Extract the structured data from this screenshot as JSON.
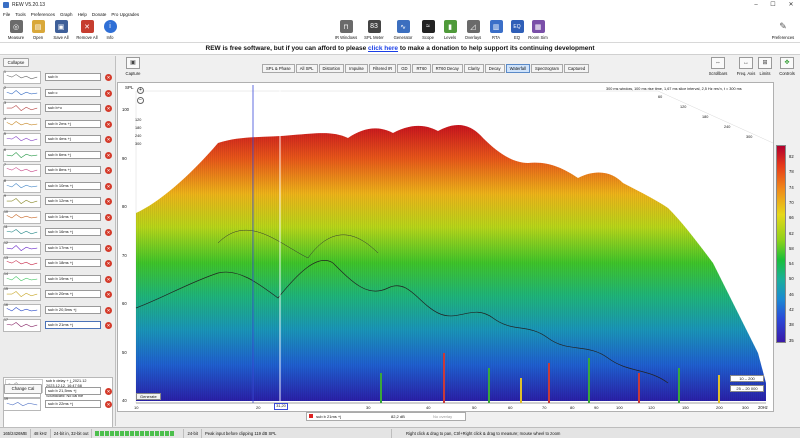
{
  "window": {
    "title": "REW V5.20.13",
    "minimize": "–",
    "maximize": "☐",
    "close": "✕"
  },
  "menu": [
    "File",
    "Tools",
    "Preferences",
    "Graph",
    "Help",
    "Donate",
    "Pro Upgrades"
  ],
  "toolbar": {
    "left": [
      {
        "label": "Measure",
        "icon": "measure-icon",
        "color": "#6b6b6b",
        "glyph": "◎"
      },
      {
        "label": "Open",
        "icon": "folder-icon",
        "color": "#d9a83a",
        "glyph": "▤"
      },
      {
        "label": "Save All",
        "icon": "save-icon",
        "color": "#3e5f99",
        "glyph": "▣"
      },
      {
        "label": "Remove All",
        "icon": "remove-all-icon",
        "color": "#c63d2f",
        "glyph": "✕"
      },
      {
        "label": "Info",
        "icon": "info-icon",
        "color": "#2f6fd6",
        "glyph": "i"
      }
    ],
    "right": [
      {
        "label": "IR Windows",
        "icon": "ir-windows-icon",
        "color": "#6a6a6a",
        "glyph": "⊓"
      },
      {
        "label": "SPL Meter",
        "icon": "spl-meter-icon",
        "color": "#444444",
        "glyph": "83"
      },
      {
        "label": "Generator",
        "icon": "generator-icon",
        "color": "#3c6fbf",
        "glyph": "∿"
      },
      {
        "label": "Scope",
        "icon": "scope-icon",
        "color": "#222222",
        "glyph": "≈"
      },
      {
        "label": "Levels",
        "icon": "levels-icon",
        "color": "#4f9a3a",
        "glyph": "▮"
      },
      {
        "label": "Overlays",
        "icon": "overlays-icon",
        "color": "#6a6a6a",
        "glyph": "◿"
      },
      {
        "label": "RTA",
        "icon": "rta-icon",
        "color": "#3b6fc8",
        "glyph": "▥"
      },
      {
        "label": "EQ",
        "icon": "eq-icon",
        "color": "#2f5fb8",
        "glyph": "EQ"
      },
      {
        "label": "Room Sim",
        "icon": "room-sim-icon",
        "color": "#7a4fa8",
        "glyph": "▦"
      }
    ],
    "preferences": {
      "label": "Preferences",
      "icon": "wrench-icon",
      "glyph": "✎"
    }
  },
  "banner": {
    "text_before": "REW is free software, but if you can afford to please ",
    "link": "click here",
    "text_after": " to make a donation to help support its continuing development"
  },
  "left_panel": {
    "collapse": "Collapse",
    "capture": "Capture",
    "change_cal": "Change Cal",
    "measurements": [
      {
        "num": "1",
        "name": "sub b"
      },
      {
        "num": "2",
        "name": "sub c"
      },
      {
        "num": "3",
        "name": "sub b+c"
      },
      {
        "num": "4",
        "name": "sub b 2ms +j"
      },
      {
        "num": "5",
        "name": "sub b 4ms +j"
      },
      {
        "num": "6",
        "name": "sub b 6ms +j"
      },
      {
        "num": "7",
        "name": "sub b 8ms +j"
      },
      {
        "num": "8",
        "name": "sub b 10ms +j"
      },
      {
        "num": "9",
        "name": "sub b 12ms +j"
      },
      {
        "num": "10",
        "name": "sub b 14ms +j"
      },
      {
        "num": "11",
        "name": "sub b 16ms +j"
      },
      {
        "num": "12",
        "name": "sub b 17ms +j"
      },
      {
        "num": "13",
        "name": "sub b 18ms +j"
      },
      {
        "num": "14",
        "name": "sub b 19ms +j"
      },
      {
        "num": "15",
        "name": "sub b 20ms +j"
      },
      {
        "num": "16",
        "name": "sub b 20,5ms +j"
      },
      {
        "num": "17",
        "name": "sub b 21ms +j"
      }
    ],
    "detail": {
      "lines": [
        "sub b delay + j_2021.12",
        "2023.12.12, 16:47:58",
        "Mic/Meter: 7888754_90de",
        "Soundcard: No cal file"
      ]
    },
    "bottom_measurements": [
      {
        "num": "18",
        "name": "sub b 21,5ms +j"
      },
      {
        "num": "19",
        "name": "sub b 22ms +j"
      }
    ]
  },
  "graph_tabs": [
    "SPL & Phase",
    "All SPL",
    "Distortion",
    "Impulse",
    "Filtered IR",
    "GD",
    "RT60",
    "RT60 Decay",
    "Clarity",
    "Decay",
    "Waterfall",
    "Spectrogram",
    "Captured"
  ],
  "active_tab": "Waterfall",
  "right_tools": [
    {
      "label": "Scrollbars",
      "icon": "scrollbars-icon",
      "glyph": "⇔"
    },
    {
      "label": "Freq. Axis",
      "icon": "freq-axis-icon",
      "glyph": "↔"
    },
    {
      "label": "Limits",
      "icon": "limits-icon",
      "glyph": "⊞"
    },
    {
      "label": "Controls",
      "icon": "controls-icon",
      "glyph": "✥"
    }
  ],
  "graph": {
    "ylabel": "SPL",
    "info": "300 ms window, 100 ms rise time, 1,67 ms slice interval, 2,5 Hz res'n, t = 300 ms",
    "y_ticks": [
      "100",
      "90",
      "80",
      "70",
      "60",
      "50",
      "40"
    ],
    "depth_ticks": [
      "120",
      "180",
      "240",
      "300"
    ],
    "depth_ticks_right": [
      "60",
      "120",
      "180",
      "240",
      "300"
    ],
    "x_ticks": [
      "10",
      "20",
      "30",
      "40",
      "50",
      "60",
      "70",
      "80",
      "90",
      "100",
      "120",
      "150",
      "200",
      "300"
    ],
    "x_unit": "20Hz",
    "generate": "Generate",
    "zoom_in": "+",
    "zoom_out": "−",
    "legend_label": "sub b 21ms +j",
    "legend_value": "82,2 dB",
    "legend_extra": "No overlay",
    "cursor_readout": "31,20",
    "range1": "10 – 200",
    "range2": "25 – 20 000",
    "colorbar_labels": [
      "82",
      "78",
      "74",
      "70",
      "66",
      "62",
      "58",
      "54",
      "50",
      "46",
      "42",
      "38",
      "35"
    ]
  },
  "status": {
    "memory": "165/2426MB",
    "rate": "48 kHz",
    "bits": "24-bit in, 32-bit out",
    "meter_label": "",
    "depth": "24-bit",
    "peak": "Peak input before clipping 119 dB SPL",
    "hint": "Right click & drag to pan, Ctrl+Right click & drag to measure; mouse wheel to zoom"
  },
  "colors": {
    "accent": "#2f6fd6",
    "tab_active": "#cfe3fb",
    "delete": "#d43a2a"
  }
}
